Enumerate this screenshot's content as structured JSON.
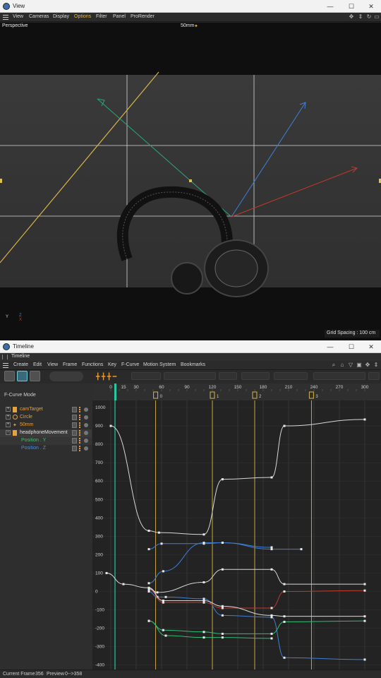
{
  "view_window": {
    "title": "View",
    "menu": [
      "View",
      "Cameras",
      "Display",
      "Options",
      "Filter",
      "Panel",
      "ProRender"
    ],
    "active_menu": "Options",
    "viewport_label": "Perspective",
    "camera_label": "50mm",
    "grid_spacing": "Grid Spacing : 100 cm",
    "axis_y": "Y",
    "axis_z": "Z",
    "axis_x": "X"
  },
  "timeline_window": {
    "title": "Timeline",
    "tab": "Timeline",
    "menu": [
      "Create",
      "Edit",
      "View",
      "Frame",
      "Functions",
      "Key",
      "F-Curve",
      "Motion System",
      "Bookmarks"
    ],
    "mode_label": "F-Curve Mode",
    "tree": [
      {
        "label": "camTarget",
        "color": "#e6a23c"
      },
      {
        "label": "Circle",
        "color": "#e6a23c"
      },
      {
        "label": "50mm",
        "color": "#e6a23c"
      },
      {
        "label": "headphoneMovement",
        "color": "#e0e0e0"
      },
      {
        "label": "Position . Y",
        "color": "#3fc16a"
      },
      {
        "label": "Position . Z",
        "color": "#4a8fe0"
      }
    ],
    "ruler_labels": [
      "0",
      "15",
      "30",
      "60",
      "90",
      "120",
      "150",
      "180",
      "210",
      "240",
      "270",
      "300"
    ],
    "marker_labels": [
      "0",
      "1",
      "2",
      "3"
    ],
    "value_labels": [
      "1000",
      "900",
      "800",
      "700",
      "600",
      "500",
      "400",
      "300",
      "200",
      "100",
      "0",
      "-100",
      "-200",
      "-300",
      "-400"
    ],
    "status": {
      "current_frame_label": "Current Frame",
      "current_frame": "356",
      "preview_label": "Preview",
      "preview_range": "0-->358"
    }
  },
  "colors": {
    "accent_yellow": "#d9b44a",
    "curve_white": "#d8d8d8",
    "curve_blue": "#3f7fd6",
    "curve_red": "#c0392b",
    "curve_green": "#2ebc73",
    "playhead": "#27c9a0"
  },
  "chart_data": {
    "type": "line",
    "x_unit": "frames",
    "xlim": [
      0,
      300
    ],
    "ylim": [
      -400,
      1000
    ],
    "series": [
      {
        "color": "white",
        "x": [
          0,
          45,
          57,
          110,
          132,
          190,
          205,
          300
        ],
        "y": [
          900,
          330,
          320,
          310,
          610,
          620,
          900,
          935
        ]
      },
      {
        "color": "blue",
        "x": [
          45,
          60,
          110,
          132,
          190,
          225
        ],
        "y": [
          230,
          260,
          260,
          265,
          230,
          230
        ]
      },
      {
        "color": "blue",
        "x": [
          45,
          62,
          110,
          132,
          190
        ],
        "y": [
          45,
          110,
          265,
          265,
          240
        ]
      },
      {
        "color": "white",
        "x": [
          -5,
          15,
          45,
          55,
          110,
          132,
          190,
          205,
          300
        ],
        "y": [
          100,
          40,
          20,
          -5,
          50,
          120,
          120,
          40,
          40
        ]
      },
      {
        "color": "blue",
        "x": [
          45,
          55,
          65,
          110,
          132,
          190,
          205,
          300
        ],
        "y": [
          0,
          -30,
          -30,
          -40,
          -130,
          -140,
          -360,
          -370
        ]
      },
      {
        "color": "red",
        "x": [
          45,
          62,
          110,
          132,
          190,
          205,
          300
        ],
        "y": [
          10,
          -60,
          -60,
          -90,
          -90,
          0,
          5
        ]
      },
      {
        "color": "white",
        "x": [
          45,
          62,
          110,
          132,
          190,
          205,
          300
        ],
        "y": [
          15,
          -50,
          -50,
          -80,
          -130,
          -135,
          -135
        ]
      },
      {
        "color": "green",
        "x": [
          45,
          62,
          110,
          132,
          190,
          205,
          300
        ],
        "y": [
          -160,
          -210,
          -220,
          -230,
          -230,
          -165,
          -160
        ]
      },
      {
        "color": "green",
        "x": [
          45,
          65,
          110,
          132,
          190
        ],
        "y": [
          -160,
          -240,
          -250,
          -250,
          -255
        ]
      }
    ]
  }
}
